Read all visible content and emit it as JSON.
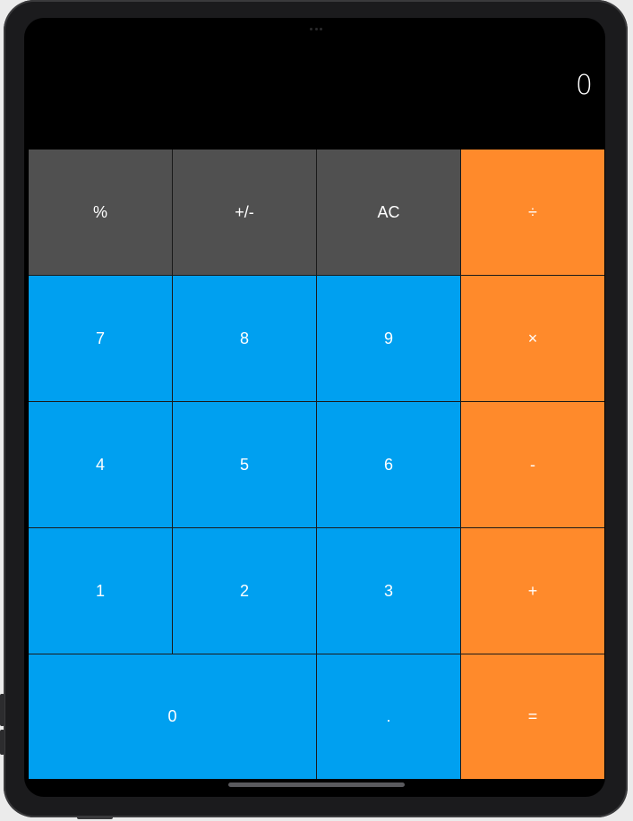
{
  "display": {
    "value": "0"
  },
  "keys": {
    "row1": [
      "%",
      "+/-",
      "AC",
      "÷"
    ],
    "row2": [
      "7",
      "8",
      "9",
      "×"
    ],
    "row3": [
      "4",
      "5",
      "6",
      "-"
    ],
    "row4": [
      "1",
      "2",
      "3",
      "+"
    ],
    "row5": [
      "0",
      ".",
      "="
    ]
  },
  "colors": {
    "function_key": "#505050",
    "digit_key": "#00a0f0",
    "operator_key": "#ff8a2b",
    "screen_background": "#000000"
  }
}
